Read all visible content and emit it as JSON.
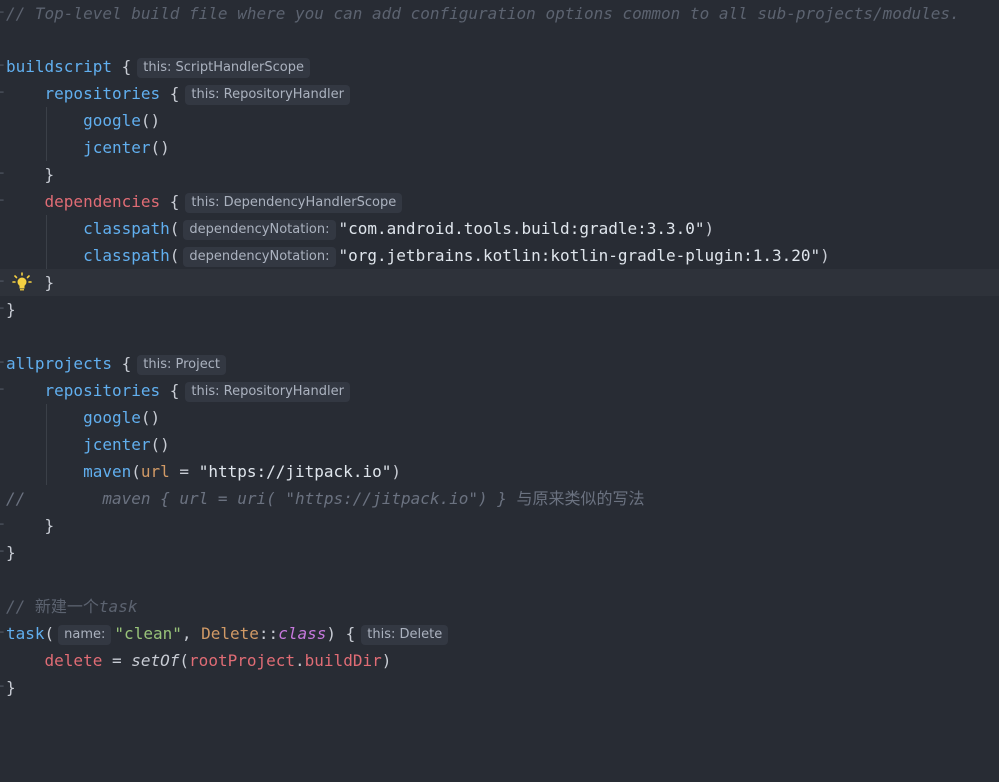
{
  "lines": {
    "l1_comment": "// Top-level build file where you can add configuration options common to all sub-projects/modules.",
    "buildscript": "buildscript",
    "brace_open": "{",
    "brace_close": "}",
    "repositories": "repositories",
    "dependencies": "dependencies",
    "google": "google",
    "jcenter": "jcenter",
    "parens": "()",
    "classpath": "classpath",
    "paren_open": "(",
    "paren_close": ")",
    "classpath1_value": "\"com.android.tools.build:gradle:3.3.0\"",
    "classpath2_value": "\"org.jetbrains.kotlin:kotlin-gradle-plugin:1.3.20\"",
    "allprojects": "allprojects",
    "maven": "maven",
    "url": "url",
    "eq": " = ",
    "jitpack": "\"https://jitpack.io\"",
    "commented_maven_prefix": "//        maven { url = uri( ",
    "commented_maven_str": "\"https://jitpack.io\"",
    "commented_maven_suffix": ") } ",
    "commented_maven_cn": "与原来类似的写法",
    "new_task_comment_prefix": "// ",
    "new_task_comment_cn": "新建一个",
    "new_task_comment_en": "task",
    "task": "task",
    "clean": "\"clean\"",
    "comma": ", ",
    "delete_class": "Delete",
    "colons": "::",
    "class_kw": "class",
    "delete": "delete",
    "setOf": "setOf",
    "rootProject": "rootProject",
    "dot": ".",
    "buildDir": "buildDir"
  },
  "hints": {
    "script_handler": "this: ScriptHandlerScope",
    "repo_handler": "this: RepositoryHandler",
    "dep_handler": "this: DependencyHandlerScope",
    "dep_notation": "dependencyNotation:",
    "project": "this: Project",
    "name_param": "name:",
    "delete_this": "this: Delete"
  },
  "icons": {
    "intention_bulb": "lightbulb-icon",
    "fold": "fold-marker-icon"
  },
  "colors": {
    "background": "#282c34",
    "function": "#61afef",
    "keyword_red": "#e06c75",
    "string": "#98c379",
    "comment": "#5c6370",
    "bulb": "#f5d142"
  }
}
